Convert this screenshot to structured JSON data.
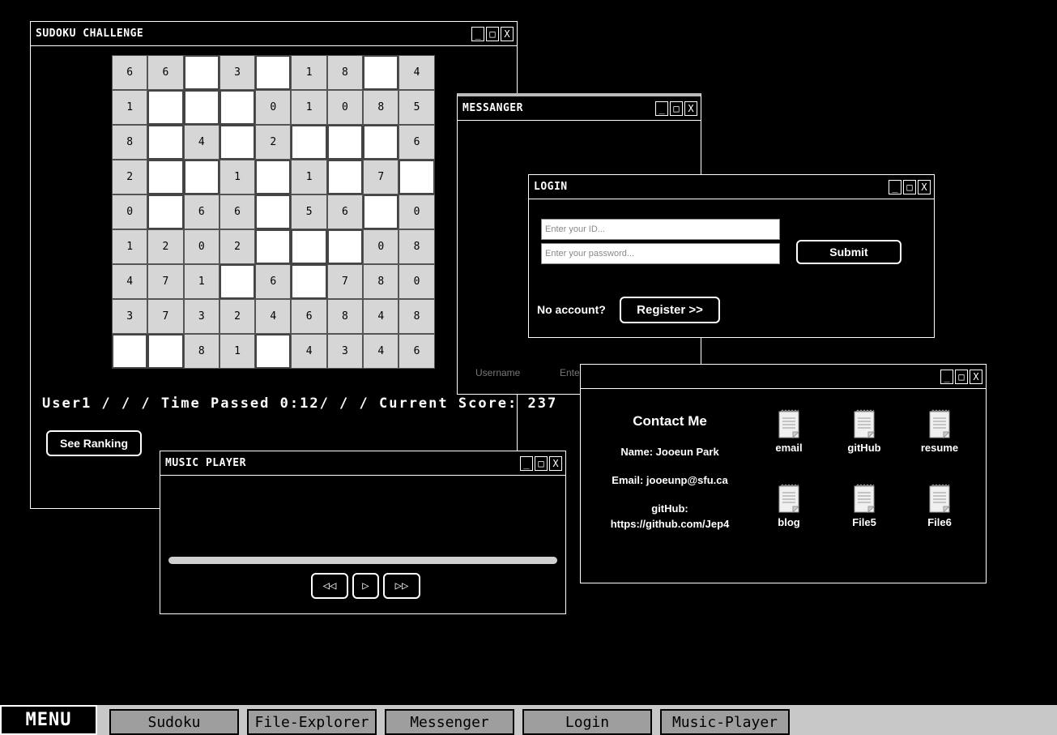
{
  "sudoku": {
    "title": "SUDOKU CHALLENGE",
    "grid": [
      [
        "6",
        "6",
        "",
        "3",
        "",
        "1",
        "8",
        "",
        "4"
      ],
      [
        "1",
        "",
        "",
        "",
        "0",
        "1",
        "0",
        "8",
        "5"
      ],
      [
        "8",
        "",
        "4",
        "",
        "2",
        "",
        "",
        "",
        "6"
      ],
      [
        "2",
        "",
        "",
        "1",
        "",
        "1",
        "",
        "7",
        ""
      ],
      [
        "0",
        "",
        "6",
        "6",
        "",
        "5",
        "6",
        "",
        "0"
      ],
      [
        "1",
        "2",
        "0",
        "2",
        "",
        "",
        "",
        "0",
        "8"
      ],
      [
        "4",
        "7",
        "1",
        "",
        "6",
        "",
        "7",
        "8",
        "0"
      ],
      [
        "3",
        "7",
        "3",
        "2",
        "4",
        "6",
        "8",
        "4",
        "8"
      ],
      [
        "",
        "",
        "8",
        "1",
        "",
        "4",
        "3",
        "4",
        "6"
      ]
    ],
    "status": "User1 / / / Time Passed 0:12/ / / Current Score: 237",
    "ranking_label": "See Ranking"
  },
  "window_buttons": {
    "minimize": "_",
    "maximize": "□",
    "close": "X"
  },
  "messenger": {
    "title": "MESSANGER",
    "username_placeholder": "Username",
    "message_placeholder": "Enter your message..."
  },
  "login": {
    "title": "LOGIN",
    "id_placeholder": "Enter your ID...",
    "password_placeholder": "Enter your password...",
    "submit_label": "Submit",
    "no_account_label": "No account?",
    "register_label": "Register >>"
  },
  "contact": {
    "heading": "Contact Me",
    "name_line": "Name: Jooeun Park",
    "email_line": "Email: jooeunp@sfu.ca",
    "github_label": "gitHub:",
    "github_url": "https://github.com/Jep4",
    "files": [
      "email",
      "gitHub",
      "resume",
      "blog",
      "File5",
      "File6"
    ]
  },
  "music": {
    "title": "MUSIC PLAYER",
    "rewind": "◁◁",
    "play": "▷",
    "forward": "▷▷"
  },
  "taskbar": {
    "menu_label": "MENU",
    "items": [
      "Sudoku",
      "File-Explorer",
      "Messenger",
      "Login",
      "Music-Player"
    ]
  }
}
